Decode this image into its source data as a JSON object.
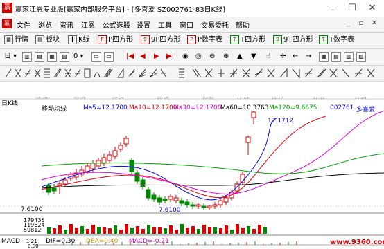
{
  "window": {
    "app_icon": "赢",
    "title": "赢家江恩专业版[赢家内部服务平台] - [多喜爱  SZ002761-83日K线]",
    "min": "—",
    "max": "☐",
    "close": "✕"
  },
  "menu": {
    "logo": "赢",
    "items": [
      "文件",
      "浏览",
      "资讯",
      "江恩",
      "公式选股",
      "设置",
      "工具",
      "窗口",
      "交易委托",
      "帮助"
    ],
    "mdi": [
      "_",
      "▫",
      "✕"
    ]
  },
  "toolbar1": {
    "items": [
      "行情",
      "板块",
      "K线",
      "P四方形",
      "9P四方形",
      "P数字表",
      "T四方形",
      "9T四方形",
      "T数字表"
    ]
  },
  "toolbar2": {
    "dropdown1": "日",
    "dropdown2": "0",
    "arrows": [
      "▲",
      "▼"
    ]
  },
  "chart": {
    "period": "日K线",
    "indicator_name": "移动均线",
    "ma": [
      {
        "label": "Ma5=12.1700",
        "color": "#0000ff"
      },
      {
        "label": "Ma10=12.1700",
        "color": "#e00000"
      },
      {
        "label": "Ma30=12.1700",
        "color": "#e000e0"
      },
      {
        "label": "Ma60=10.3763",
        "color": "#000000"
      },
      {
        "label": "Ma120=9.6675",
        "color": "#00a000"
      }
    ],
    "code": "002761",
    "name": "多喜爱",
    "high_label": "12.1712",
    "low_label": "7.6100",
    "price_axis": "7.6100",
    "volume_labels": [
      "179436",
      "119624",
      "59812"
    ],
    "dates": [
      "08-26",
      "09-09",
      "09-24",
      "10-16",
      "10-30",
      "11-13",
      "11-27",
      "12-11",
      "12-25"
    ],
    "macd_name": "MACD",
    "dif": "DIF=0.30",
    "dea": "DEA=0.40",
    "macd": "MACD=-0.21",
    "macd_axis": [
      "1.21",
      "0.00"
    ],
    "watermark": "www.9360.com"
  }
}
